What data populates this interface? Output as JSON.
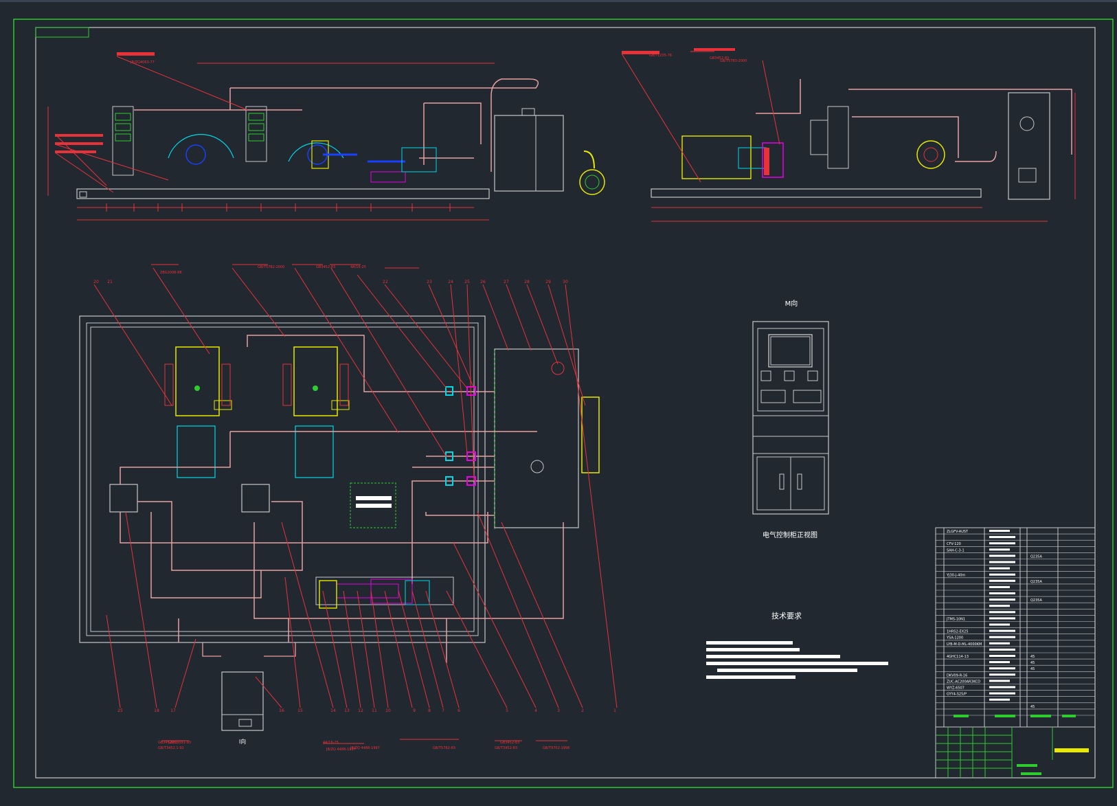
{
  "drawing": {
    "view_m_label": "M向",
    "cabinet_caption": "电气控制柜正视图",
    "tech_req_title": "技术要求",
    "view_i_label": "I向"
  },
  "colors": {
    "background": "#212830",
    "frame": "#2ecc2e",
    "dimension": "#e8323a",
    "pipe": "#e8a0a0",
    "equipment": "#c8c8c8",
    "highlight": "#e8e800",
    "cyan": "#00d8e8"
  },
  "callouts": {
    "top": [
      "20",
      "21",
      "22",
      "23",
      "24",
      "25",
      "26",
      "27",
      "28",
      "29",
      "30"
    ],
    "bottom": [
      "25",
      "18",
      "17",
      "16",
      "15",
      "14",
      "13",
      "12",
      "11",
      "10",
      "9",
      "8",
      "7",
      "6",
      "5",
      "4",
      "3",
      "2",
      "1"
    ]
  },
  "bom_codes": [
    "ZLGFV-AUST",
    "CFV-120",
    "SAH-C-3-1",
    "YJ30-J-40m",
    "JTMS-10N1",
    "1HRS2-EX25",
    "YSA-1200",
    "LYB-M-D-ML-4000KM",
    "4GHC114-13",
    "DKV09-R-16",
    "ZUC-AC200AR3KCD",
    "WYZ-6507",
    "GYY4-S25/P"
  ],
  "bom_specs": [
    "Q235A",
    "Q235A",
    "Q235A",
    "45",
    "45",
    "45",
    "45"
  ],
  "standards": [
    "JB/ZQ4063-77",
    "GB/T3452.1-92",
    "GB/T3091-93",
    "GB/T5783-2000",
    "GB/T1235-76",
    "JB/ZQ 4488-1997",
    "GB3452-83",
    "GB/T5782-2000",
    "4A/16-25",
    "ZBG2008-88",
    "GB3452-83",
    "GB/T3452-83",
    "GB3452-83",
    "4A/16-25",
    "JB/ZQ 4488-1997",
    "GB/T5782-83",
    "GB3452-83",
    "GB/T9702-1998"
  ]
}
